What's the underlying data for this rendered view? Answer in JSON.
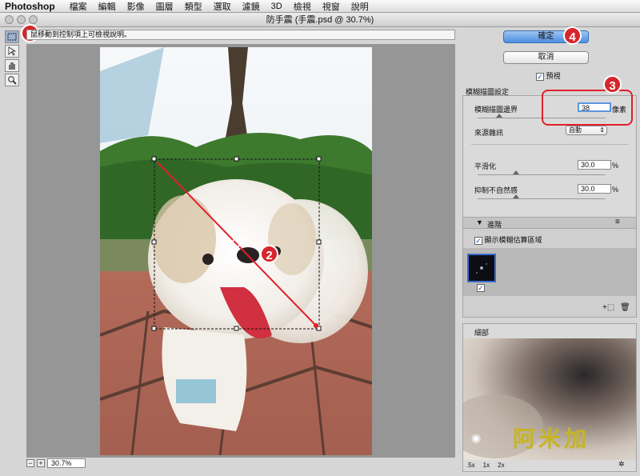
{
  "menu": {
    "app": "Photoshop",
    "items": [
      "檔案",
      "編輯",
      "影像",
      "圖層",
      "類型",
      "選取",
      "濾鏡",
      "3D",
      "檢視",
      "視窗",
      "說明"
    ]
  },
  "window": {
    "title": "防手震 (手震.psd @ 30.7%)"
  },
  "hint": {
    "text": "鼠移動到控制項上可檢視說明。"
  },
  "tools": [
    "blur-estimation-tool",
    "blur-direction-tool",
    "hand-tool",
    "zoom-tool"
  ],
  "zoom": {
    "value": "30.7%"
  },
  "buttons": {
    "ok": "確定",
    "cancel": "取消"
  },
  "preview": {
    "label": "預視",
    "checked": true
  },
  "blur_trace": {
    "header": "模糊描圖設定",
    "bounds_label": "模糊描圖邊界",
    "bounds_value": "38",
    "bounds_unit": "像素",
    "bounds_slider_pct": 17,
    "noise_label": "來源雜訊",
    "noise_value": "自動",
    "smooth_label": "平滑化",
    "smooth_value": "30.0",
    "smooth_unit": "%",
    "smooth_slider_pct": 30,
    "artifact_label": "抑制不自然感",
    "artifact_value": "30.0",
    "artifact_unit": "%",
    "artifact_slider_pct": 30
  },
  "advanced": {
    "header": "進階",
    "show_region_label": "顯示模糊估算區域",
    "show_region_checked": true
  },
  "detail": {
    "header": "細部",
    "zoom_levels": [
      ".5x",
      "1x",
      "2x"
    ]
  },
  "watermark": {
    "text": "阿米加"
  },
  "callouts": [
    "1",
    "2",
    "3",
    "4"
  ],
  "colors": {
    "accent_red": "#d7262b",
    "primary_button": "#4d8fe0"
  }
}
